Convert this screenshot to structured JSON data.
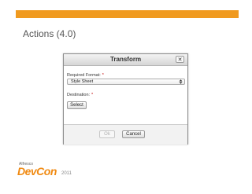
{
  "slide": {
    "title": "Actions (4.0)"
  },
  "dialog": {
    "title": "Transform",
    "close_label": "✕",
    "fields": {
      "format": {
        "label": "Required Format:",
        "required_marker": "*",
        "value": "Style Sheet"
      },
      "destination": {
        "label": "Destination:",
        "required_marker": "*",
        "button_label": "Select"
      }
    },
    "footer": {
      "ok_label": "Ok",
      "cancel_label": "Cancel"
    }
  },
  "logo": {
    "small_text": "Alfresco",
    "main_text": "DevCon",
    "year_text": "2011"
  },
  "colors": {
    "accent": "#f09a1f",
    "logo_orange": "#f08a12",
    "required": "#c00000"
  },
  "icons": {
    "close": "close-icon",
    "select_arrows": "updown-arrows-icon"
  }
}
